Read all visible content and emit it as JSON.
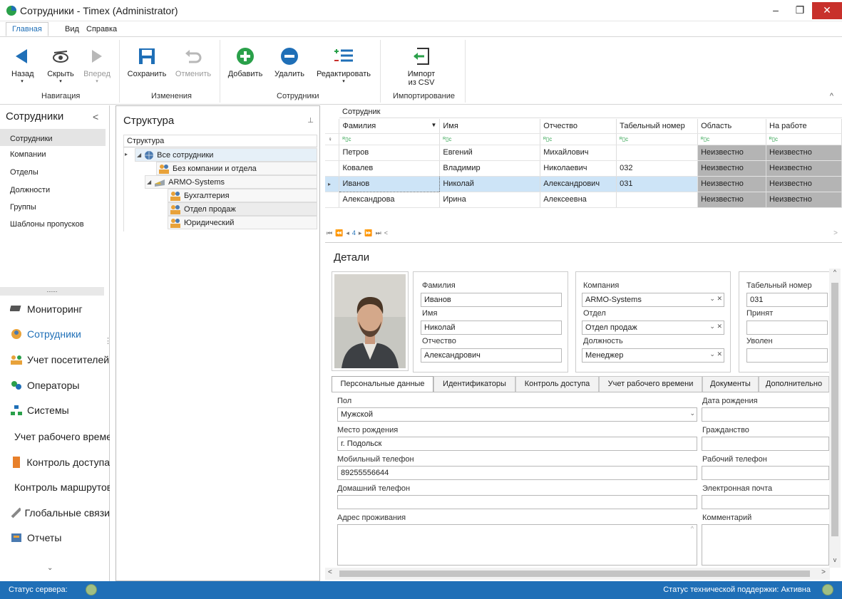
{
  "window": {
    "title": "Сотрудники - Timex (Administrator)"
  },
  "menu": [
    "Главная",
    "Вид",
    "Справка"
  ],
  "ribbon": {
    "buttons": [
      {
        "label": "Назад"
      },
      {
        "label": "Скрыть"
      },
      {
        "label": "Вперед"
      },
      {
        "label": "Сохранить"
      },
      {
        "label": "Отменить"
      },
      {
        "label": "Добавить"
      },
      {
        "label": "Удалить"
      },
      {
        "label": "Редактировать"
      },
      {
        "label": "Импорт"
      },
      {
        "label": "из CSV"
      }
    ],
    "groups": [
      "Навигация",
      "Изменения",
      "Сотрудники",
      "Импортирование"
    ]
  },
  "leftnav": {
    "title": "Сотрудники",
    "sub": [
      "Сотрудники",
      "Компании",
      "Отделы",
      "Должности",
      "Группы",
      "Шаблоны пропусков"
    ],
    "dots": "......",
    "big": [
      {
        "label": "Мониторинг",
        "icon": "monitor-icon"
      },
      {
        "label": "Сотрудники",
        "icon": "employees-icon"
      },
      {
        "label": "Учет посетителей",
        "icon": "visitors-icon"
      },
      {
        "label": "Операторы",
        "icon": "operators-icon"
      },
      {
        "label": "Системы",
        "icon": "systems-icon"
      },
      {
        "label": "Учет рабочего времени",
        "icon": "clock-icon"
      },
      {
        "label": "Контроль доступа",
        "icon": "door-icon"
      },
      {
        "label": "Контроль маршрутов",
        "icon": "route-icon"
      },
      {
        "label": "Глобальные связи",
        "icon": "link-icon"
      },
      {
        "label": "Отчеты",
        "icon": "reports-icon"
      }
    ]
  },
  "structure": {
    "title": "Структура",
    "col": "Структура",
    "nodes": [
      "Все сотрудники",
      "Без компании и отдела",
      "ARMO-Systems",
      "Бухгалтерия",
      "Отдел продаж",
      "Юридический"
    ]
  },
  "grid": {
    "band": "Сотрудник",
    "columns": [
      "Фамилия",
      "Имя",
      "Отчество",
      "Табельный номер",
      "Область",
      "На работе"
    ],
    "rows": [
      [
        "Петров",
        "Евгений",
        "Михайлович",
        "",
        "Неизвестно",
        "Неизвестно"
      ],
      [
        "Ковалев",
        "Владимир",
        "Николаевич",
        "032",
        "Неизвестно",
        "Неизвестно"
      ],
      [
        "Иванов",
        "Николай",
        "Александрович",
        "031",
        "Неизвестно",
        "Неизвестно"
      ],
      [
        "Александрова",
        "Ирина",
        "Алексеевна",
        "",
        "Неизвестно",
        "Неизвестно"
      ]
    ],
    "count": "4"
  },
  "details": {
    "title": "Детали",
    "last_label": "Фамилия",
    "last": "Иванов",
    "first_label": "Имя",
    "first": "Николай",
    "middle_label": "Отчество",
    "middle": "Александрович",
    "company_label": "Компания",
    "company": "ARMO-Systems",
    "dept_label": "Отдел",
    "dept": "Отдел продаж",
    "pos_label": "Должность",
    "pos": "Менеджер",
    "tab_label": "Табельный номер",
    "tabnum": "031",
    "hired_label": "Принят",
    "hired": "",
    "fired_label": "Уволен",
    "fired": "",
    "tabs": [
      "Персональные данные",
      "Идентификаторы",
      "Контроль доступа",
      "Учет рабочего времени",
      "Документы",
      "Дополнительно"
    ],
    "gender_label": "Пол",
    "gender": "Мужской",
    "birth_date_label": "Дата рождения",
    "birth_place_label": "Место рождения",
    "birth_place": "г. Подольск",
    "citizen_label": "Гражданство",
    "mobile_label": "Мобильный телефон",
    "mobile": "89255556644",
    "work_phone_label": "Рабочий телефон",
    "home_phone_label": "Домашний телефон",
    "email_label": "Электронная почта",
    "address_label": "Адрес проживания",
    "comment_label": "Комментарий"
  },
  "status": {
    "server": "Статус сервера:",
    "support": "Статус технической поддержки: Активна"
  },
  "colors": {
    "accent": "#1f6fb7",
    "ok": "#9fbf84",
    "selected": "#cde4f7"
  }
}
